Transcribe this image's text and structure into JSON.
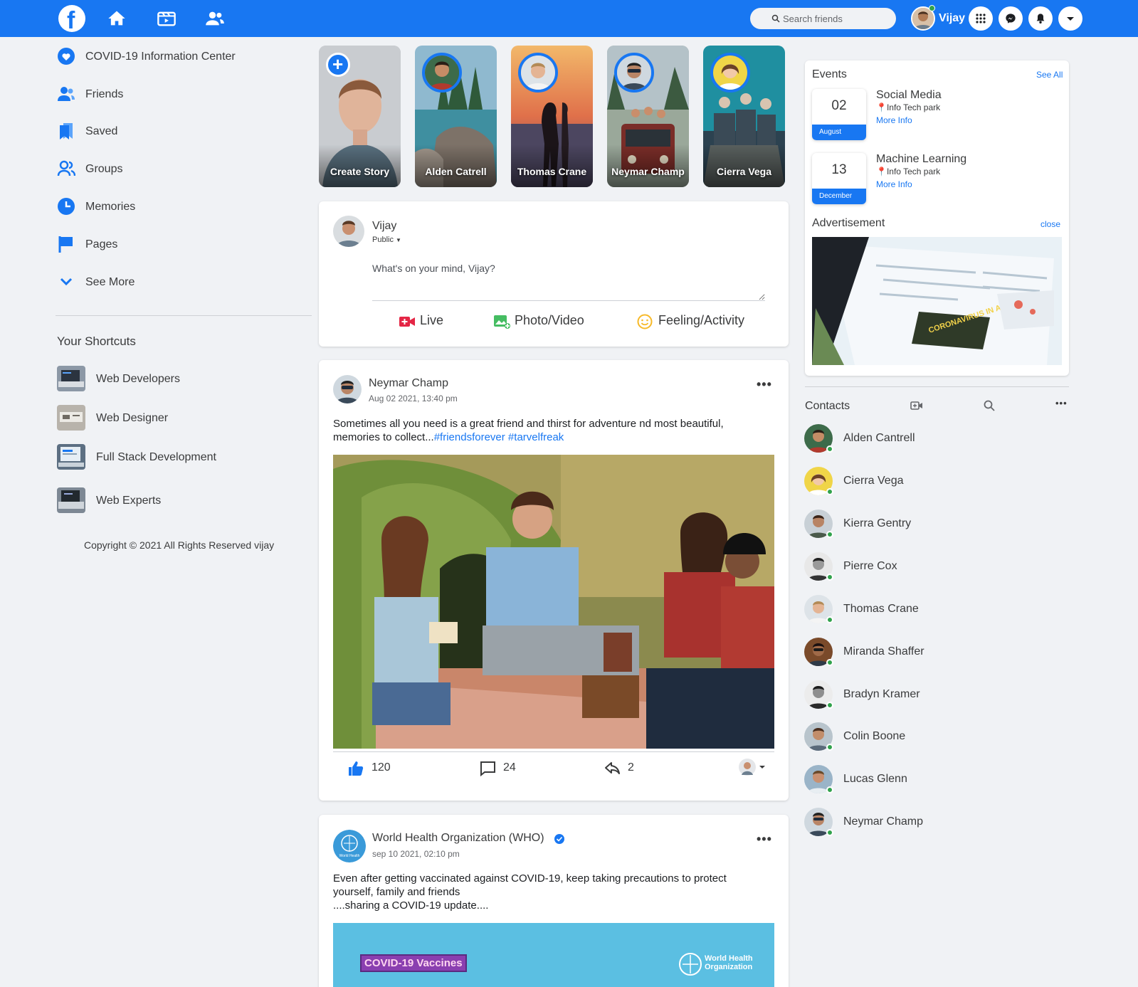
{
  "topbar": {
    "brand_icon": "facebook-logo",
    "nav_icons": [
      "home-icon",
      "watch-icon",
      "friends-icon"
    ],
    "search_placeholder": "Search friends",
    "user_name": "Vijay",
    "right_icons": [
      "menu-grid-icon",
      "messenger-icon",
      "notifications-icon",
      "account-dropdown-icon"
    ]
  },
  "sidebar": {
    "items": [
      {
        "label": "COVID-19 Information Center",
        "icon": "heart-icon"
      },
      {
        "label": "Friends",
        "icon": "friends-icon"
      },
      {
        "label": "Saved",
        "icon": "bookmark-icon"
      },
      {
        "label": "Groups",
        "icon": "groups-icon"
      },
      {
        "label": "Memories",
        "icon": "clock-icon"
      },
      {
        "label": "Pages",
        "icon": "flag-icon"
      },
      {
        "label": "See More",
        "icon": "chevron-down-icon"
      }
    ],
    "shortcuts_title": "Your Shortcuts",
    "shortcuts": [
      {
        "label": "Web Developers"
      },
      {
        "label": "Web Designer"
      },
      {
        "label": "Full Stack Development"
      },
      {
        "label": "Web Experts"
      }
    ],
    "copyright": "Copyright © 2021 All Rights Reserved vijay"
  },
  "stories": [
    {
      "label": "Create Story"
    },
    {
      "label": "Alden Catrell"
    },
    {
      "label": "Thomas Crane"
    },
    {
      "label": "Neymar Champ"
    },
    {
      "label": "Cierra Vega"
    }
  ],
  "composer": {
    "user_name": "Vijay",
    "audience": "Public",
    "placeholder": "What's on your mind, Vijay?",
    "actions": [
      {
        "label": "Live",
        "icon": "live-video-icon",
        "color": "#e42645"
      },
      {
        "label": "Photo/Video",
        "icon": "photo-icon",
        "color": "#45bd62"
      },
      {
        "label": "Feeling/Activity",
        "icon": "smile-icon",
        "color": "#f7b928"
      }
    ]
  },
  "posts": [
    {
      "author": "Neymar Champ",
      "time": "Aug 02 2021, 13:40 pm",
      "text": "Sometimes all you need is a great friend and thirst for adventure nd most beautiful, memories to collect...",
      "hashtags": "#friendsforever #tarvelfreak",
      "likes": "120",
      "comments": "24",
      "shares": "2"
    },
    {
      "author": "World Health Organization (WHO)",
      "verified": true,
      "time": "sep 10 2021, 02:10 pm",
      "text_line1": "Even after getting vaccinated against COVID-19, keep taking precautions to protect",
      "text_line2": "yourself, family and friends",
      "text_line3": "....sharing a COVID-19 update....",
      "banner_label": "COVID-19 Vaccines",
      "banner_org_line1": "World Health",
      "banner_org_line2": "Organization"
    }
  ],
  "events": {
    "title": "Events",
    "see_all": "See All",
    "items": [
      {
        "day": "02",
        "month": "August",
        "title": "Social Media",
        "location": "Info Tech park",
        "more": "More Info"
      },
      {
        "day": "13",
        "month": "December",
        "title": "Machine Learning",
        "location": "Info Tech park",
        "more": "More Info"
      }
    ]
  },
  "advertisement": {
    "title": "Advertisement",
    "close": "close",
    "banner_text": "CORONAVIRUS IN ARKANSAS"
  },
  "contacts": {
    "title": "Contacts",
    "icons": [
      "new-room-icon",
      "search-icon",
      "more-icon"
    ],
    "items": [
      {
        "name": "Alden Cantrell"
      },
      {
        "name": "Cierra Vega"
      },
      {
        "name": "Kierra Gentry"
      },
      {
        "name": "Pierre Cox"
      },
      {
        "name": "Thomas Crane"
      },
      {
        "name": "Miranda Shaffer"
      },
      {
        "name": "Bradyn Kramer"
      },
      {
        "name": "Colin Boone"
      },
      {
        "name": "Lucas Glenn"
      },
      {
        "name": "Neymar Champ"
      }
    ]
  },
  "colors": {
    "brand": "#1877f2",
    "online": "#31a24c",
    "background": "#f0f2f5"
  }
}
